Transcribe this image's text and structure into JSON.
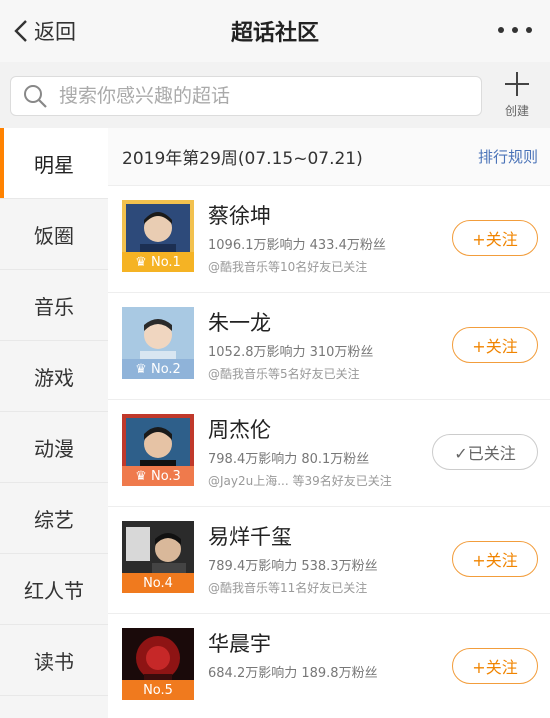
{
  "nav": {
    "back_label": "返回",
    "title": "超话社区"
  },
  "search": {
    "placeholder": "搜索你感兴趣的超话",
    "create_label": "创建"
  },
  "sidebar": {
    "items": [
      {
        "label": "明星",
        "active": true
      },
      {
        "label": "饭圈"
      },
      {
        "label": "音乐"
      },
      {
        "label": "游戏"
      },
      {
        "label": "动漫"
      },
      {
        "label": "综艺"
      },
      {
        "label": "红人节"
      },
      {
        "label": "读书"
      }
    ]
  },
  "ranking": {
    "week_label": "2019年第29周(07.15~07.21)",
    "rules_label": "排行规则",
    "rows": [
      {
        "rank": "No.1",
        "name": "蔡徐坤",
        "stats": "1096.1万影响力 433.4万粉丝",
        "friends": "@酷我音乐等10名好友已关注",
        "follow": "+关注"
      },
      {
        "rank": "No.2",
        "name": "朱一龙",
        "stats": "1052.8万影响力 310万粉丝",
        "friends": "@酷我音乐等5名好友已关注",
        "follow": "+关注"
      },
      {
        "rank": "No.3",
        "name": "周杰伦",
        "stats": "798.4万影响力 80.1万粉丝",
        "friends": "@Jay2u上海...   等39名好友已关注",
        "follow": "✓已关注"
      },
      {
        "rank": "No.4",
        "name": "易烊千玺",
        "stats": "789.4万影响力 538.3万粉丝",
        "friends": "@酷我音乐等11名好友已关注",
        "follow": "+关注"
      },
      {
        "rank": "No.5",
        "name": "华晨宇",
        "stats": "684.2万影响力 189.8万粉丝",
        "friends": "",
        "follow": "+关注"
      }
    ]
  },
  "colors": {
    "accent": "#ff8200",
    "link": "#4a73b8",
    "gold": "#f5b324",
    "silver": "#8fb3d9",
    "bronze": "#ef7a4c",
    "orange": "#f07a1e"
  }
}
